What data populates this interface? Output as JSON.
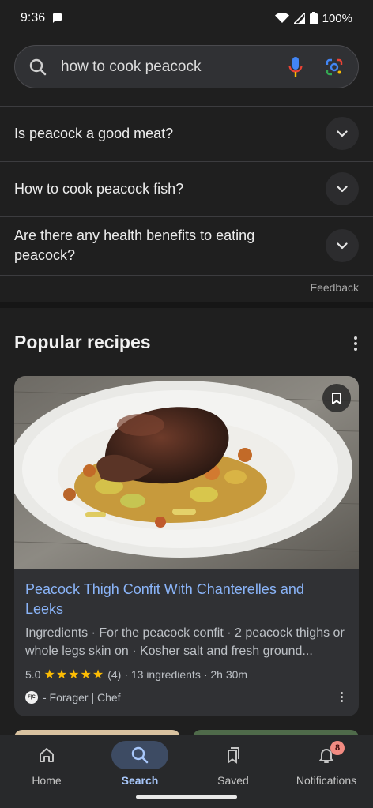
{
  "status_bar": {
    "time": "9:36",
    "battery": "100%"
  },
  "search": {
    "query": "how to cook peacock"
  },
  "questions": [
    {
      "text": "Is peacock a good meat?"
    },
    {
      "text": "How to cook peacock fish?"
    },
    {
      "text": "Are there any health benefits to eating peacock?"
    }
  ],
  "feedback_label": "Feedback",
  "popular": {
    "title": "Popular recipes",
    "card": {
      "title": "Peacock Thigh Confit With Chanterelles and Leeks",
      "description": "Ingredients · For the peacock confit · 2 peacock thighs or whole legs skin on · Kosher salt and fresh ground...",
      "rating": "5.0",
      "stars": "★★★★★",
      "review_count": "(4)",
      "ingredients": "· 13 ingredients",
      "time": "· 2h 30m",
      "source_logo": "F|C",
      "source": "- Forager | Chef"
    }
  },
  "nav": {
    "items": [
      {
        "label": "Home",
        "icon": "home-icon"
      },
      {
        "label": "Search",
        "icon": "search-icon"
      },
      {
        "label": "Saved",
        "icon": "saved-icon"
      },
      {
        "label": "Notifications",
        "icon": "bell-icon"
      }
    ],
    "badge": "8"
  },
  "colors": {
    "accent": "#8ab4f8",
    "active_nav": "#a8c7fa",
    "star": "#fbbc04",
    "badge": "#f28b82"
  }
}
